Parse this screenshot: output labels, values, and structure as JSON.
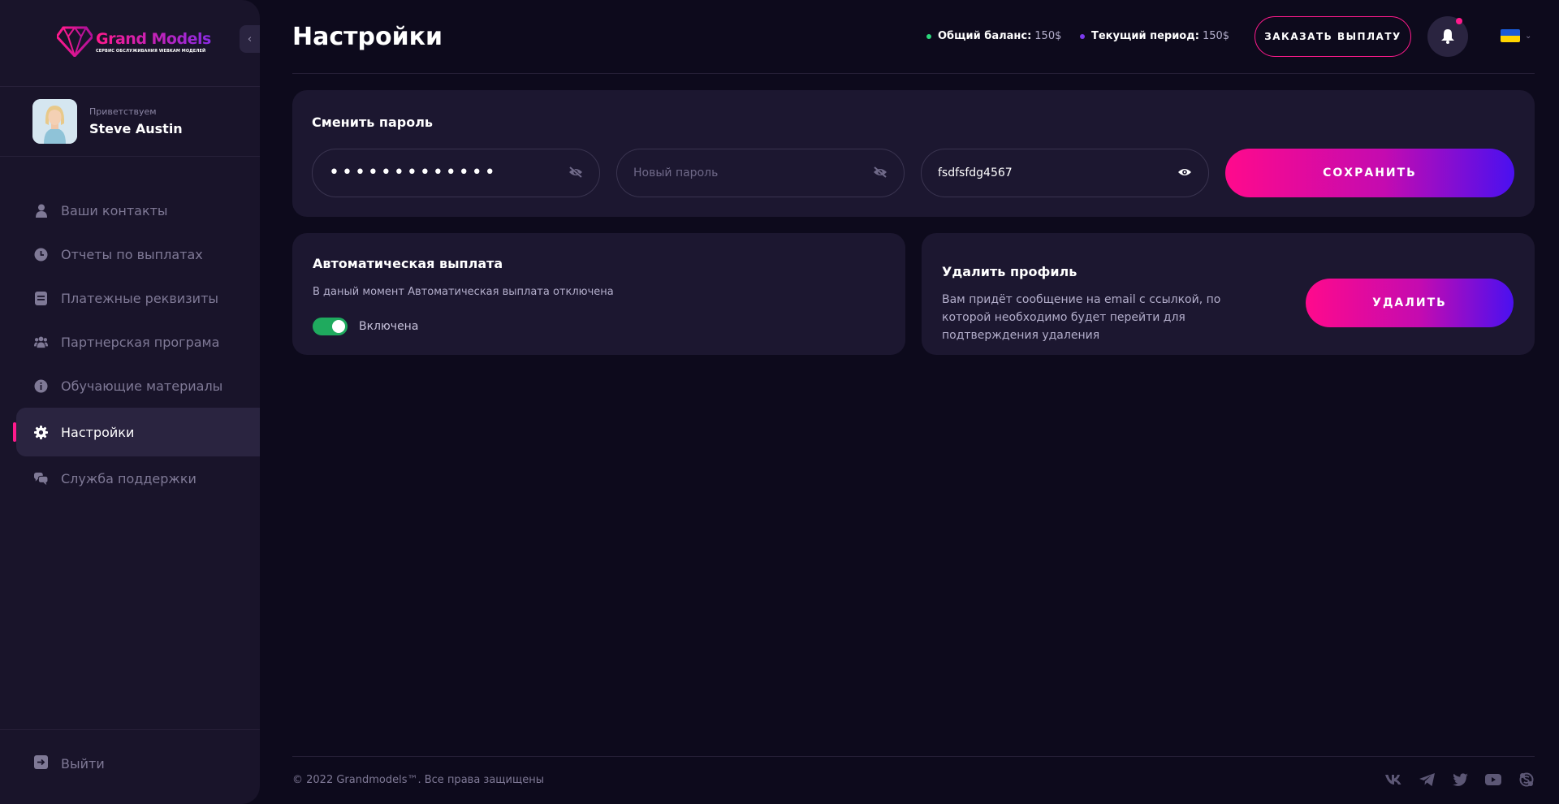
{
  "brand": {
    "title": "Grand Models",
    "subtitle": "СЕРВИС ОБСЛУЖИВАНИЯ WEBKAM МОДЕЛЕЙ"
  },
  "user": {
    "greeting": "Приветствуем",
    "name": "Steve Austin"
  },
  "nav": [
    {
      "label": "Ваши контакты",
      "icon": "user-icon",
      "active": false
    },
    {
      "label": "Отчеты по выплатах",
      "icon": "clock-icon",
      "active": false
    },
    {
      "label": "Платежные реквизиты",
      "icon": "document-icon",
      "active": false
    },
    {
      "label": "Партнерская програма",
      "icon": "users-icon",
      "active": false
    },
    {
      "label": "Обучающие материалы",
      "icon": "info-icon",
      "active": false
    },
    {
      "label": "Настройки",
      "icon": "gear-icon",
      "active": true
    },
    {
      "label": "Служба поддержки",
      "icon": "chat-icon",
      "active": false
    }
  ],
  "logout": {
    "label": "Выйти",
    "icon": "logout-icon"
  },
  "header": {
    "title": "Настройки",
    "balance_label": "Общий баланс:",
    "balance_value": "150$",
    "period_label": "Текущий период:",
    "period_value": "150$",
    "payout_button": "ЗАКАЗАТЬ ВЫПЛАТУ",
    "language": "uk-flag"
  },
  "colors": {
    "accent": "#ff1a8c",
    "accent2": "#4a10f0",
    "success": "#1faa5e",
    "balance_dot": "#2bd67b",
    "period_dot": "#7c3aed"
  },
  "password": {
    "title": "Сменить пароль",
    "current_value": "•••••••••••••",
    "new_placeholder": "Новый пароль",
    "confirm_value": "fsdfsfdg4567",
    "save_button": "СОХРАНИТЬ"
  },
  "autopay": {
    "title": "Автоматическая выплата",
    "description": "В даный момент Автоматическая выплата отключена",
    "toggle_label": "Включена",
    "toggle_on": true
  },
  "delete_profile": {
    "title": "Удалить профиль",
    "description": "Вам придёт сообщение на email с ссылкой, по которой необходимо будет перейти для подтверждения удаления",
    "button": "УДАЛИТЬ"
  },
  "footer": {
    "copyright": "© 2022 Grandmodels™. Все права защищены",
    "socials": [
      "vk-icon",
      "telegram-icon",
      "twitter-icon",
      "youtube-icon",
      "skype-icon"
    ]
  }
}
